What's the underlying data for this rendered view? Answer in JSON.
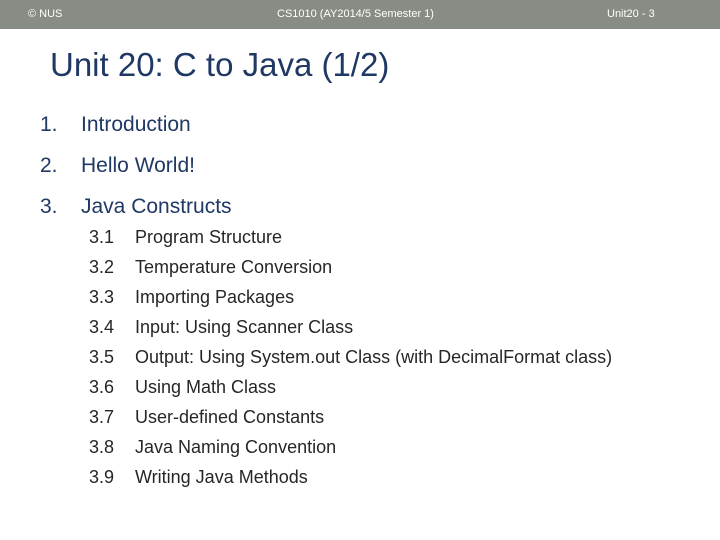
{
  "footer": {
    "left": "© NUS",
    "center": "CS1010 (AY2014/5 Semester 1)",
    "right": "Unit20 - 3"
  },
  "title": "Unit 20: C to Java (1/2)",
  "items": [
    {
      "num": "1.",
      "label": "Introduction"
    },
    {
      "num": "2.",
      "label": "Hello World!"
    },
    {
      "num": "3.",
      "label": "Java Constructs"
    }
  ],
  "subitems": [
    {
      "num": "3.1",
      "label": "Program Structure"
    },
    {
      "num": "3.2",
      "label": "Temperature Conversion"
    },
    {
      "num": "3.3",
      "label": "Importing Packages"
    },
    {
      "num": "3.4",
      "label": "Input: Using Scanner Class"
    },
    {
      "num": "3.5",
      "label": "Output: Using System.out Class (with DecimalFormat class)"
    },
    {
      "num": "3.6",
      "label": "Using Math Class"
    },
    {
      "num": "3.7",
      "label": "User-defined Constants"
    },
    {
      "num": "3.8",
      "label": "Java Naming Convention"
    },
    {
      "num": "3.9",
      "label": "Writing Java Methods"
    }
  ]
}
